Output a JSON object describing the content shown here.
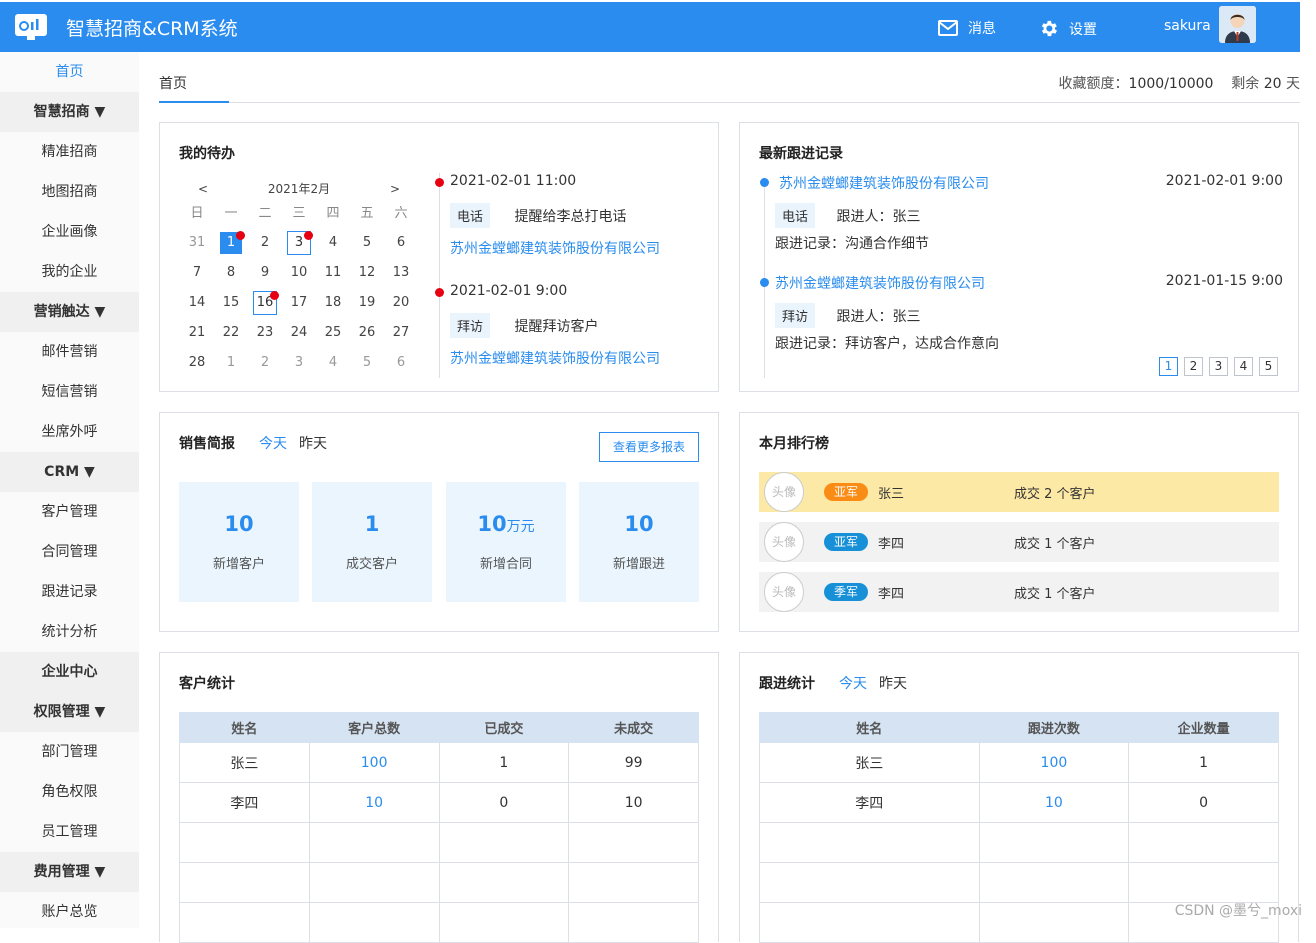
{
  "header": {
    "title": "智慧招商&CRM系统",
    "messages": "消息",
    "settings": "设置",
    "username": "sakura"
  },
  "sidebar": [
    {
      "label": "首页",
      "type": "active"
    },
    {
      "label": "智慧招商 ▼",
      "type": "group"
    },
    {
      "label": "精准招商",
      "type": "item"
    },
    {
      "label": "地图招商",
      "type": "item"
    },
    {
      "label": "企业画像",
      "type": "item"
    },
    {
      "label": "我的企业",
      "type": "item"
    },
    {
      "label": "营销触达 ▼",
      "type": "group"
    },
    {
      "label": "邮件营销",
      "type": "item"
    },
    {
      "label": "短信营销",
      "type": "item"
    },
    {
      "label": "坐席外呼",
      "type": "item"
    },
    {
      "label": "CRM ▼",
      "type": "group"
    },
    {
      "label": "客户管理",
      "type": "item"
    },
    {
      "label": "合同管理",
      "type": "item"
    },
    {
      "label": "跟进记录",
      "type": "item"
    },
    {
      "label": "统计分析",
      "type": "item"
    },
    {
      "label": "企业中心",
      "type": "group"
    },
    {
      "label": "权限管理 ▼",
      "type": "group"
    },
    {
      "label": "部门管理",
      "type": "item"
    },
    {
      "label": "角色权限",
      "type": "item"
    },
    {
      "label": "员工管理",
      "type": "item"
    },
    {
      "label": "费用管理 ▼",
      "type": "group"
    },
    {
      "label": "账户总览",
      "type": "item"
    }
  ],
  "tabs": {
    "home": "首页"
  },
  "quota": {
    "label": "收藏额度：",
    "used": "1000",
    "sep": "/",
    "total": "10000",
    "remain_prefix": "剩余",
    "remain_days": "20",
    "remain_suffix": "天"
  },
  "todo": {
    "title": "我的待办",
    "calendar": {
      "prev": "<",
      "month": "2021年2月",
      "next": ">",
      "weekdays": [
        "日",
        "一",
        "二",
        "三",
        "四",
        "五",
        "六"
      ],
      "days": [
        {
          "d": "31",
          "m": true
        },
        {
          "d": "1",
          "sel": true,
          "dot": true
        },
        {
          "d": "2"
        },
        {
          "d": "3",
          "box": true,
          "dot": true
        },
        {
          "d": "4"
        },
        {
          "d": "5"
        },
        {
          "d": "6"
        },
        {
          "d": "7"
        },
        {
          "d": "8"
        },
        {
          "d": "9"
        },
        {
          "d": "10"
        },
        {
          "d": "11"
        },
        {
          "d": "12"
        },
        {
          "d": "13"
        },
        {
          "d": "14"
        },
        {
          "d": "15"
        },
        {
          "d": "16",
          "box": true,
          "dot": true
        },
        {
          "d": "17"
        },
        {
          "d": "18"
        },
        {
          "d": "19"
        },
        {
          "d": "20"
        },
        {
          "d": "21"
        },
        {
          "d": "22"
        },
        {
          "d": "23"
        },
        {
          "d": "24"
        },
        {
          "d": "25"
        },
        {
          "d": "26"
        },
        {
          "d": "27"
        },
        {
          "d": "28"
        },
        {
          "d": "1",
          "m": true
        },
        {
          "d": "2",
          "m": true
        },
        {
          "d": "3",
          "m": true
        },
        {
          "d": "4",
          "m": true
        },
        {
          "d": "5",
          "m": true
        },
        {
          "d": "6",
          "m": true
        }
      ]
    },
    "items": [
      {
        "time": "2021-02-01  11:00",
        "tag": "电话",
        "text": "提醒给李总打电话",
        "company": "苏州金螳螂建筑装饰股份有限公司"
      },
      {
        "time": "2021-02-01  9:00",
        "tag": "拜访",
        "text": "提醒拜访客户",
        "company": "苏州金螳螂建筑装饰股份有限公司"
      }
    ]
  },
  "records": {
    "title": "最新跟进记录",
    "items": [
      {
        "company": "苏州金螳螂建筑装饰股份有限公司",
        "time": "2021-02-01   9:00",
        "tag": "电话",
        "person": "跟进人：张三",
        "note": "跟进记录：沟通合作细节"
      },
      {
        "company": "苏州金螳螂建筑装饰股份有限公司",
        "time": "2021-01-15   9:00",
        "tag": "拜访",
        "person": "跟进人：张三",
        "note": "跟进记录：拜访客户，达成合作意向"
      }
    ],
    "pages": [
      "1",
      "2",
      "3",
      "4",
      "5"
    ]
  },
  "sales": {
    "title": "销售简报",
    "today": "今天",
    "yesterday": "昨天",
    "more": "查看更多报表",
    "stats": [
      {
        "value": "10",
        "unit": "",
        "label": "新增客户"
      },
      {
        "value": "1",
        "unit": "",
        "label": "成交客户"
      },
      {
        "value": "10",
        "unit": "万元",
        "label": "新增合同"
      },
      {
        "value": "10",
        "unit": "",
        "label": "新增跟进"
      }
    ]
  },
  "ranking": {
    "title": "本月排行榜",
    "avatar_text": "头像",
    "rows": [
      {
        "badge": "亚军",
        "color": "#fa8c16",
        "name": "张三",
        "deal": "成交 2 个客户"
      },
      {
        "badge": "亚军",
        "color": "#1890d8",
        "name": "李四",
        "deal": "成交 1 个客户"
      },
      {
        "badge": "季军",
        "color": "#1890d8",
        "name": "李四",
        "deal": "成交 1 个客户"
      }
    ]
  },
  "customer_stats": {
    "title": "客户统计",
    "headers": [
      "姓名",
      "客户总数",
      "已成交",
      "未成交"
    ],
    "rows": [
      [
        "张三",
        "100",
        "1",
        "99"
      ],
      [
        "李四",
        "10",
        "0",
        "10"
      ],
      [
        "",
        "",
        "",
        ""
      ],
      [
        "",
        "",
        "",
        ""
      ],
      [
        "",
        "",
        "",
        ""
      ]
    ]
  },
  "followup_stats": {
    "title": "跟进统计",
    "today": "今天",
    "yesterday": "昨天",
    "headers": [
      "姓名",
      "跟进次数",
      "企业数量"
    ],
    "rows": [
      [
        "张三",
        "100",
        "1"
      ],
      [
        "李四",
        "10",
        "0"
      ],
      [
        "",
        "",
        ""
      ],
      [
        "",
        "",
        ""
      ],
      [
        "",
        "",
        ""
      ]
    ]
  },
  "watermark": "CSDN @墨兮_moxi",
  "colors": {
    "primary": "#2a8cee",
    "danger": "#e60012",
    "gold": "#fde9a6"
  }
}
